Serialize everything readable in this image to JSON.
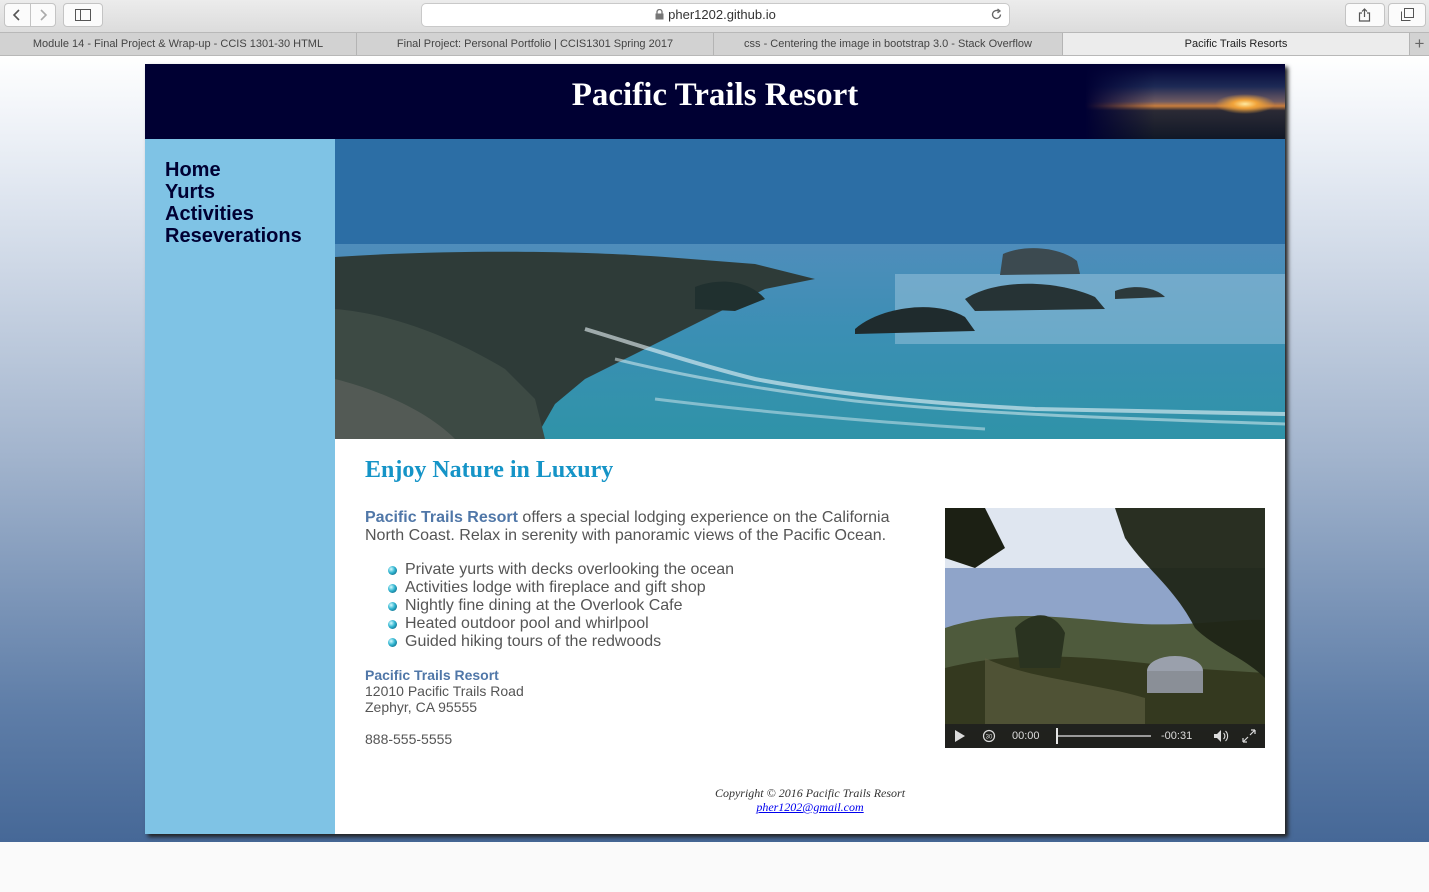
{
  "browser": {
    "url": "pher1202.github.io",
    "tabs": [
      {
        "label": "Module 14 - Final Project & Wrap-up - CCIS 1301-30 HTML",
        "active": false
      },
      {
        "label": "Final Project: Personal Portfolio | CCIS1301 Spring 2017",
        "active": false
      },
      {
        "label": "css - Centering the image in bootstrap 3.0 - Stack Overflow",
        "active": false
      },
      {
        "label": "Pacific Trails Resorts",
        "active": true
      }
    ],
    "new_tab": "+"
  },
  "site": {
    "title": "Pacific Trails Resort",
    "nav": [
      "Home",
      "Yurts",
      "Activities",
      "Reseverations"
    ],
    "headline": "Enjoy Nature in Luxury",
    "intro_brand": "Pacific Trails Resort",
    "intro_text": " offers a special lodging experience on the California North Coast. Relax in serenity with panoramic views of the Pacific Ocean.",
    "features": [
      "Private yurts with decks overlooking the ocean",
      "Activities lodge with fireplace and gift shop",
      "Nightly fine dining at the Overlook Cafe",
      "Heated outdoor pool and whirlpool",
      "Guided hiking tours of the redwoods"
    ],
    "contact": {
      "name": "Pacific Trails Resort",
      "street": "12010 Pacific Trails Road",
      "city": "Zephyr, CA 95555",
      "phone": "888-555-5555"
    },
    "video": {
      "current_time": "00:00",
      "remaining_time": "-00:31",
      "progress": 0
    },
    "footer": {
      "copyright": "Copyright © 2016 Pacific Trails Resort",
      "email": "pher1202@gmail.com"
    }
  },
  "colors": {
    "header_bg": "#000033",
    "nav_bg": "#7fc3e5",
    "headline": "#1594c7",
    "brand_text": "#5077a8"
  }
}
